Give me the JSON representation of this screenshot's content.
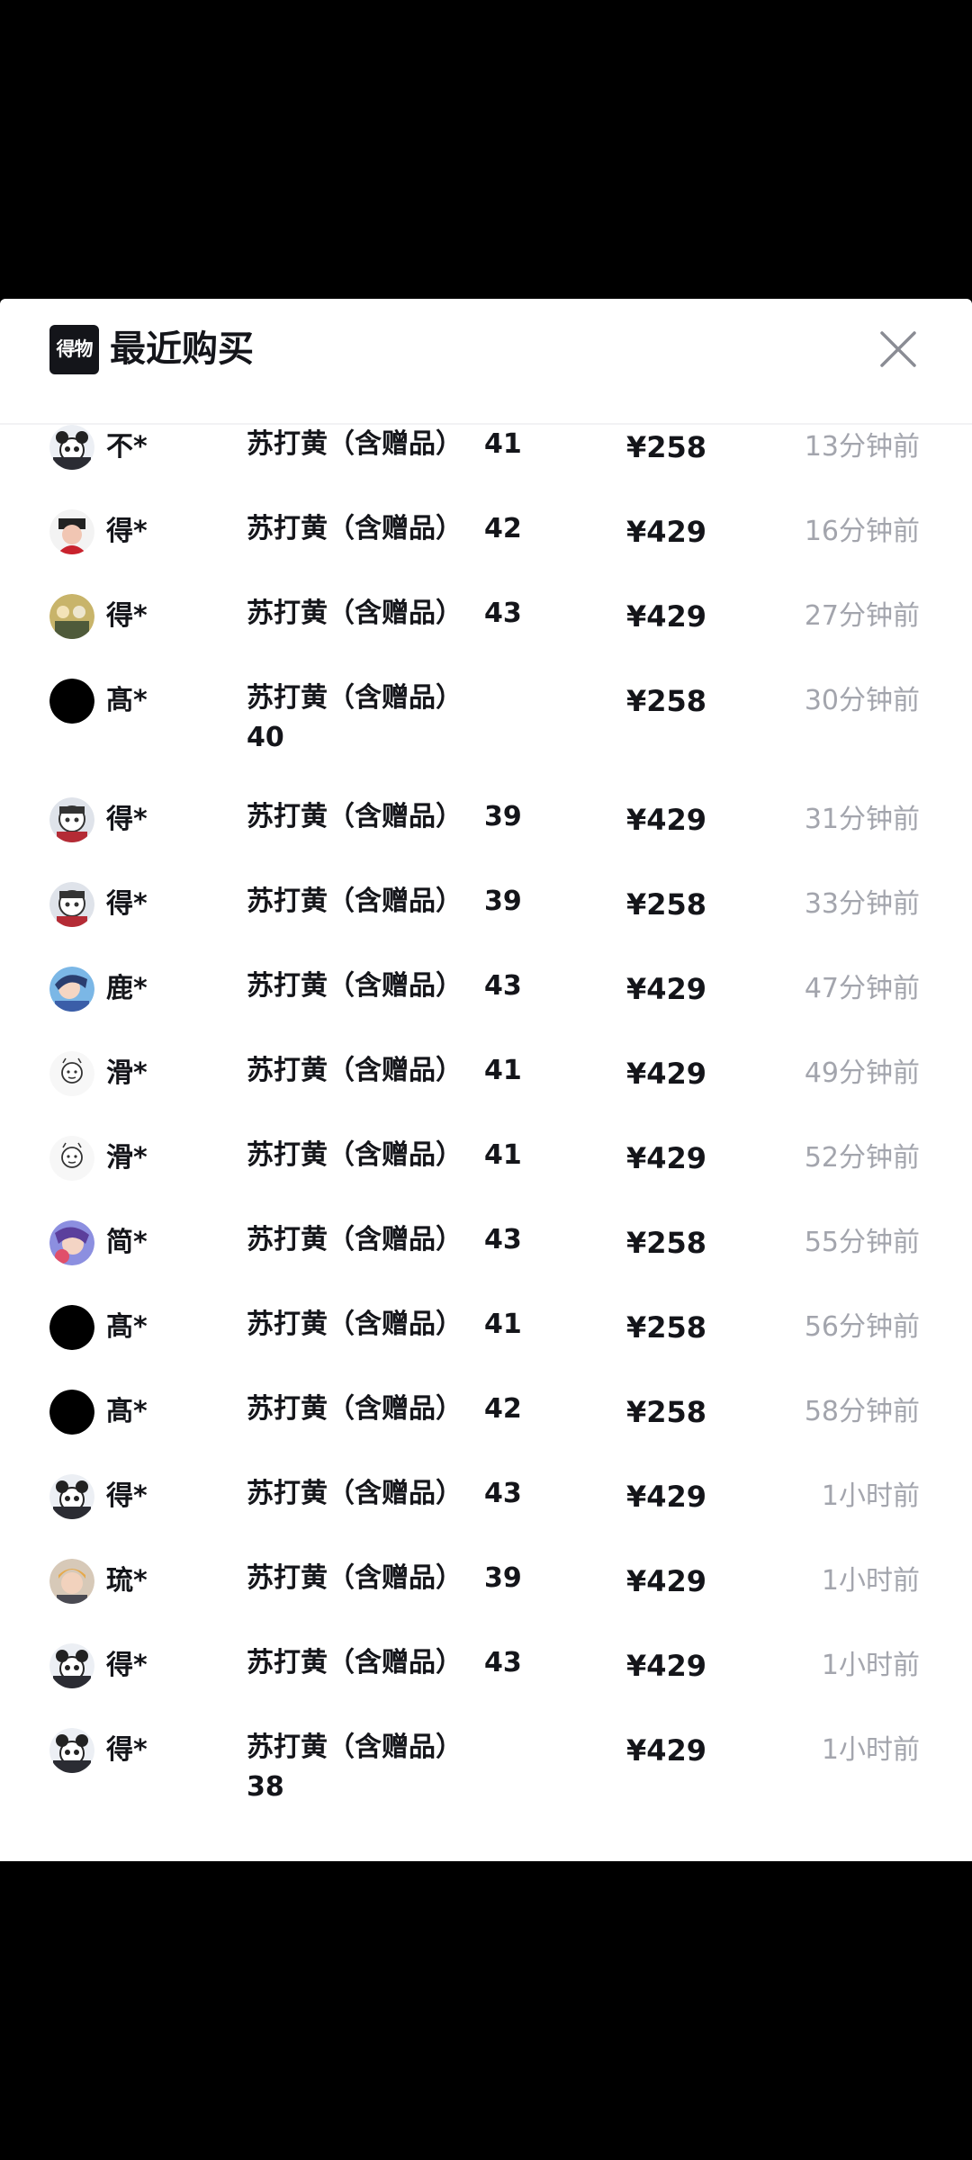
{
  "app": {
    "logo_text": "得物",
    "title": "最近购买"
  },
  "icons": {
    "close": "close-icon"
  },
  "colors": {
    "text_primary": "#14151a",
    "text_secondary": "#a3a5ad",
    "background": "#ffffff",
    "overlay": "#000000"
  },
  "purchases": [
    {
      "buyer": "不*",
      "product": "苏打黄（含赠品）",
      "size": "41",
      "price": "¥258",
      "time": "13分钟前",
      "avatar": "cartoon-panda"
    },
    {
      "buyer": "得*",
      "product": "苏打黄（含赠品）",
      "size": "42",
      "price": "¥429",
      "time": "16分钟前",
      "avatar": "red-figure"
    },
    {
      "buyer": "得*",
      "product": "苏打黄（含赠品）",
      "size": "43",
      "price": "¥429",
      "time": "27分钟前",
      "avatar": "group-photo"
    },
    {
      "buyer": "髙*",
      "product": "苏打黄（含赠品）",
      "size": "40",
      "price": "¥258",
      "time": "30分钟前",
      "avatar": "black-circle"
    },
    {
      "buyer": "得*",
      "product": "苏打黄（含赠品）",
      "size": "39",
      "price": "¥429",
      "time": "31分钟前",
      "avatar": "cartoon-face"
    },
    {
      "buyer": "得*",
      "product": "苏打黄（含赠品）",
      "size": "39",
      "price": "¥258",
      "time": "33分钟前",
      "avatar": "cartoon-face"
    },
    {
      "buyer": "鹿*",
      "product": "苏打黄（含赠品）",
      "size": "43",
      "price": "¥429",
      "time": "47分钟前",
      "avatar": "blue-anime"
    },
    {
      "buyer": "滑*",
      "product": "苏打黄（含赠品）",
      "size": "41",
      "price": "¥429",
      "time": "49分钟前",
      "avatar": "doodle"
    },
    {
      "buyer": "滑*",
      "product": "苏打黄（含赠品）",
      "size": "41",
      "price": "¥429",
      "time": "52分钟前",
      "avatar": "doodle"
    },
    {
      "buyer": "简*",
      "product": "苏打黄（含赠品）",
      "size": "43",
      "price": "¥258",
      "time": "55分钟前",
      "avatar": "purple-anime"
    },
    {
      "buyer": "髙*",
      "product": "苏打黄（含赠品）",
      "size": "41",
      "price": "¥258",
      "time": "56分钟前",
      "avatar": "black-circle"
    },
    {
      "buyer": "髙*",
      "product": "苏打黄（含赠品）",
      "size": "42",
      "price": "¥258",
      "time": "58分钟前",
      "avatar": "black-circle"
    },
    {
      "buyer": "得*",
      "product": "苏打黄（含赠品）",
      "size": "43",
      "price": "¥429",
      "time": "1小时前",
      "avatar": "cartoon-panda"
    },
    {
      "buyer": "琉*",
      "product": "苏打黄（含赠品）",
      "size": "39",
      "price": "¥429",
      "time": "1小时前",
      "avatar": "person-photo"
    },
    {
      "buyer": "得*",
      "product": "苏打黄（含赠品）",
      "size": "43",
      "price": "¥429",
      "time": "1小时前",
      "avatar": "cartoon-panda"
    },
    {
      "buyer": "得*",
      "product": "苏打黄（含赠品）",
      "size": "38",
      "price": "¥429",
      "time": "1小时前",
      "avatar": "cartoon-panda"
    }
  ]
}
